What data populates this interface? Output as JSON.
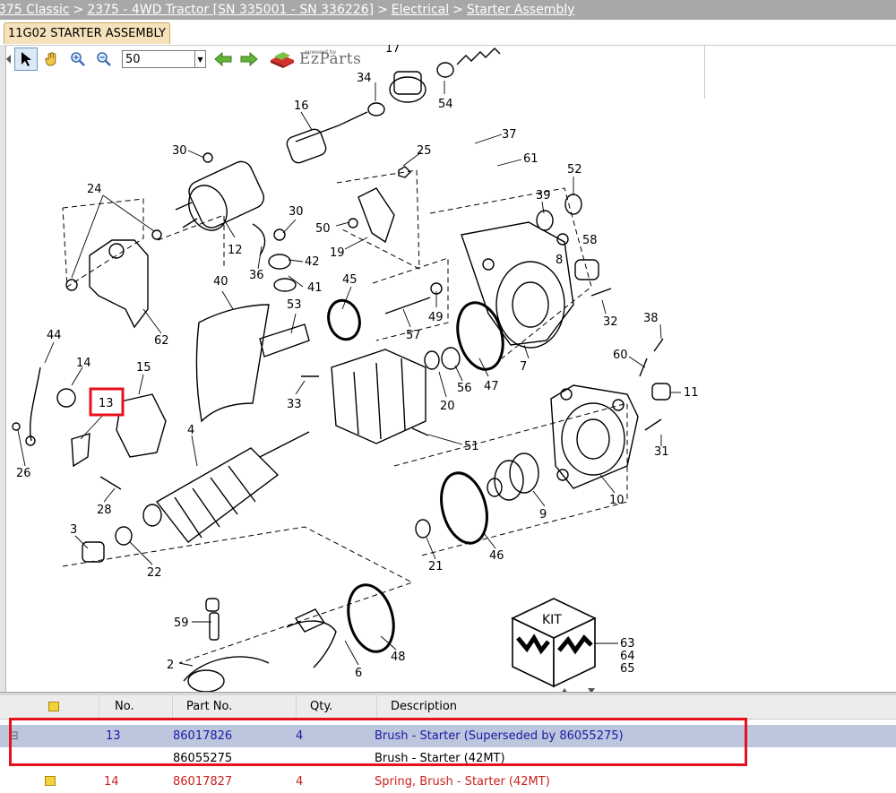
{
  "breadcrumb": {
    "items": [
      "375 Classic",
      "2375 - 4WD Tractor [SN 335001 - SN 336226]",
      "Electrical",
      "Starter Assembly"
    ],
    "separator": ">"
  },
  "tab": {
    "label": "11G02 STARTER ASSEMBLY"
  },
  "toolbar": {
    "zoom_value": "50",
    "logo_powered": "powered by",
    "logo_text": "EzParts"
  },
  "diagram": {
    "callouts": [
      "17",
      "34",
      "54",
      "16",
      "37",
      "30",
      "25",
      "61",
      "52",
      "24",
      "39",
      "12",
      "30",
      "50",
      "58",
      "19",
      "36",
      "42",
      "8",
      "41",
      "45",
      "40",
      "53",
      "32",
      "62",
      "49",
      "38",
      "57",
      "7",
      "44",
      "15",
      "60",
      "14",
      "56",
      "47",
      "13",
      "11",
      "33",
      "20",
      "51",
      "4",
      "31",
      "26",
      "28",
      "9",
      "10",
      "3",
      "22",
      "21",
      "46",
      "59",
      "48",
      "6",
      "2",
      "63",
      "64",
      "65"
    ],
    "kit_label": "KIT"
  },
  "parts_table": {
    "headers": [
      "No.",
      "Part No.",
      "Qty.",
      "Description"
    ],
    "rows": [
      {
        "no": "13",
        "part_no": "86017826",
        "qty": "4",
        "description": "Brush - Starter (Superseded by 86055275)",
        "expander": "⊟"
      },
      {
        "no": "",
        "part_no": "86055275",
        "qty": "",
        "description": "Brush - Starter (42MT)"
      },
      {
        "no": "14",
        "part_no": "86017827",
        "qty": "4",
        "description": "Spring, Brush - Starter (42MT)"
      }
    ]
  },
  "colors": {
    "highlight": "#e8101b",
    "selected_row": "#bcc6dc",
    "breadcrumb_bg": "#a8a8a8",
    "tab_bg": "#f5e2ba"
  }
}
